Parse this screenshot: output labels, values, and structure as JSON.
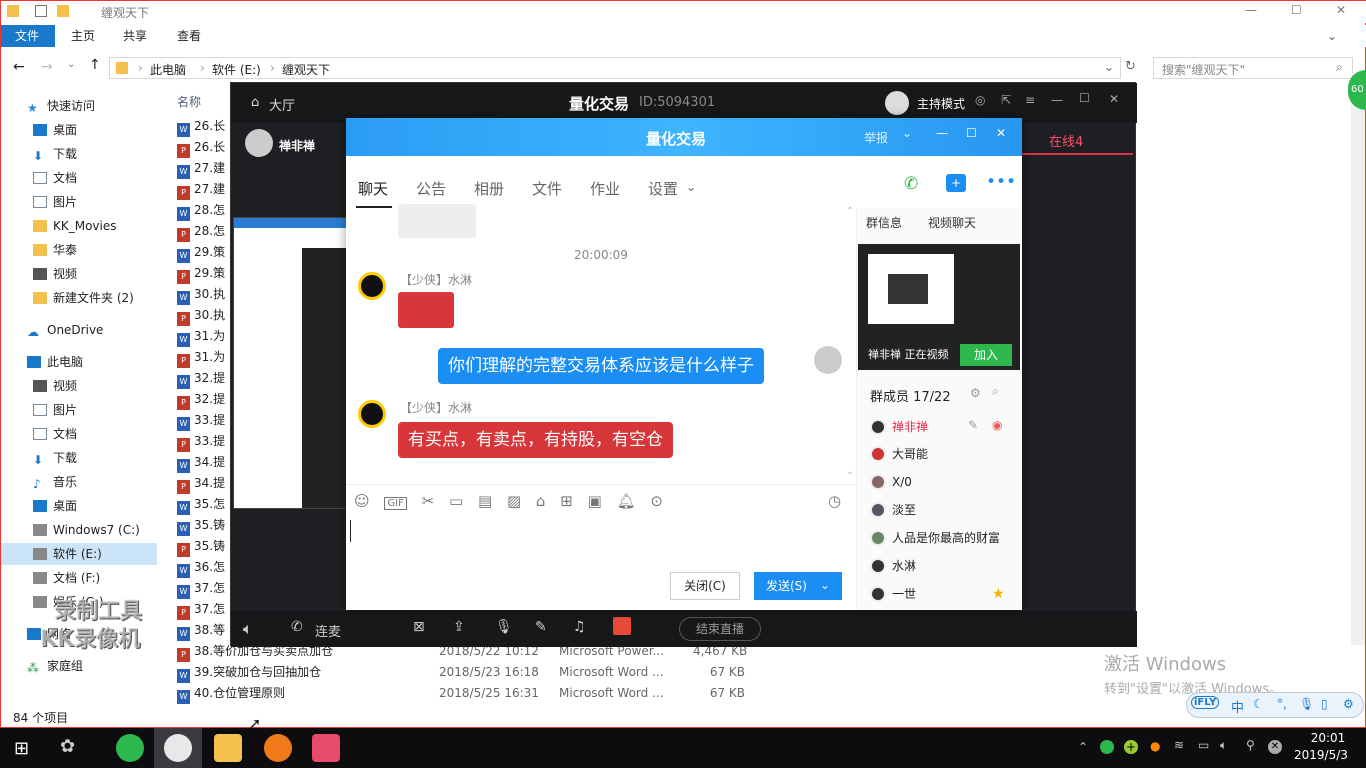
{
  "explorer": {
    "title": "缠观天下",
    "ribbon_tabs": [
      "文件",
      "主页",
      "共享",
      "查看"
    ],
    "address": [
      "此电脑",
      "软件 (E:)",
      "缠观天下"
    ],
    "search_placeholder": "搜索\"缠观天下\"",
    "column_name": "名称",
    "status": "84 个项目",
    "nav": [
      {
        "label": "快速访问"
      },
      {
        "label": "桌面"
      },
      {
        "label": "下载"
      },
      {
        "label": "文档"
      },
      {
        "label": "图片"
      },
      {
        "label": "KK_Movies"
      },
      {
        "label": "华泰"
      },
      {
        "label": "视频"
      },
      {
        "label": "新建文件夹 (2)"
      },
      {
        "label": "OneDrive"
      },
      {
        "label": "此电脑"
      },
      {
        "label": "视频"
      },
      {
        "label": "图片"
      },
      {
        "label": "文档"
      },
      {
        "label": "下载"
      },
      {
        "label": "音乐"
      },
      {
        "label": "桌面"
      },
      {
        "label": "Windows7 (C:)"
      },
      {
        "label": "软件 (E:)"
      },
      {
        "label": "文档 (F:)"
      },
      {
        "label": "娱乐 (G:)"
      },
      {
        "label": "网络"
      },
      {
        "label": "家庭组"
      }
    ],
    "files": [
      {
        "name": "26.长",
        "t": "w"
      },
      {
        "name": "26.长",
        "t": "p"
      },
      {
        "name": "27.建",
        "t": "w"
      },
      {
        "name": "27.建",
        "t": "p"
      },
      {
        "name": "28.怎",
        "t": "w"
      },
      {
        "name": "28.怎",
        "t": "p"
      },
      {
        "name": "29.策",
        "t": "w"
      },
      {
        "name": "29.策",
        "t": "p"
      },
      {
        "name": "30.执",
        "t": "w"
      },
      {
        "name": "30.执",
        "t": "p"
      },
      {
        "name": "31.为",
        "t": "w"
      },
      {
        "name": "31.为",
        "t": "p"
      },
      {
        "name": "32.提",
        "t": "w"
      },
      {
        "name": "32.提",
        "t": "p"
      },
      {
        "name": "33.提",
        "t": "w"
      },
      {
        "name": "33.提",
        "t": "p"
      },
      {
        "name": "34.提",
        "t": "w"
      },
      {
        "name": "34.提",
        "t": "p"
      },
      {
        "name": "35.怎",
        "t": "w"
      },
      {
        "name": "35.铸",
        "t": "w"
      },
      {
        "name": "35.铸",
        "t": "p"
      },
      {
        "name": "36.怎",
        "t": "w"
      },
      {
        "name": "37.怎",
        "t": "w"
      },
      {
        "name": "37.怎",
        "t": "p"
      },
      {
        "name": "38.等",
        "t": "w"
      },
      {
        "name": "38.等价加仓与买卖点加仓",
        "t": "p",
        "date": "2018/5/22 10:12",
        "type": "Microsoft Power...",
        "size": "4,467 KB"
      },
      {
        "name": "39.突破加仓与回抽加仓",
        "t": "w",
        "date": "2018/5/23 16:18",
        "type": "Microsoft Word ...",
        "size": "67 KB"
      },
      {
        "name": "40.仓位管理原则",
        "t": "w",
        "date": "2018/5/25 16:31",
        "type": "Microsoft Word ...",
        "size": "67 KB"
      }
    ]
  },
  "live": {
    "back_label": "大厅",
    "title": "量化交易",
    "id_label": "ID:5094301",
    "host_mode": "主持模式",
    "host_name": "禅非禅",
    "online": "在线4",
    "bottom": {
      "mic_label": "连麦",
      "end_live": "结束直播"
    }
  },
  "chat": {
    "title": "量化交易",
    "report": "举报",
    "tabs": [
      "聊天",
      "公告",
      "相册",
      "文件",
      "作业",
      "设置"
    ],
    "time": "20:00:09",
    "sender1": "【少侠】水淋",
    "my_message": "你们理解的完整交易体系应该是什么样子",
    "sender2": "【少侠】水淋",
    "message2": "有买点，有卖点，有持股，有空仓",
    "close_btn": "关闭(C)",
    "send_btn": "发送(S)",
    "side_tabs": [
      "群信息",
      "视频聊天"
    ],
    "video_caption": "禅非禅 正在视频",
    "join_btn": "加入",
    "members_title": "群成员 17/22",
    "members": [
      "禅非禅",
      "大哥能",
      "X/0",
      "淡至",
      "人品是你最高的财富",
      "水淋",
      "一世"
    ]
  },
  "watermark": {
    "line1": "录制工具",
    "line2": "KK录像机"
  },
  "activate": {
    "line1": "激活 Windows",
    "line2": "转到\"设置\"以激活 Windows。"
  },
  "ime": {
    "brand": "iFLY",
    "lang": "中"
  },
  "taskbar": {
    "time": "20:01",
    "date": "2019/5/3"
  },
  "badge": "60"
}
